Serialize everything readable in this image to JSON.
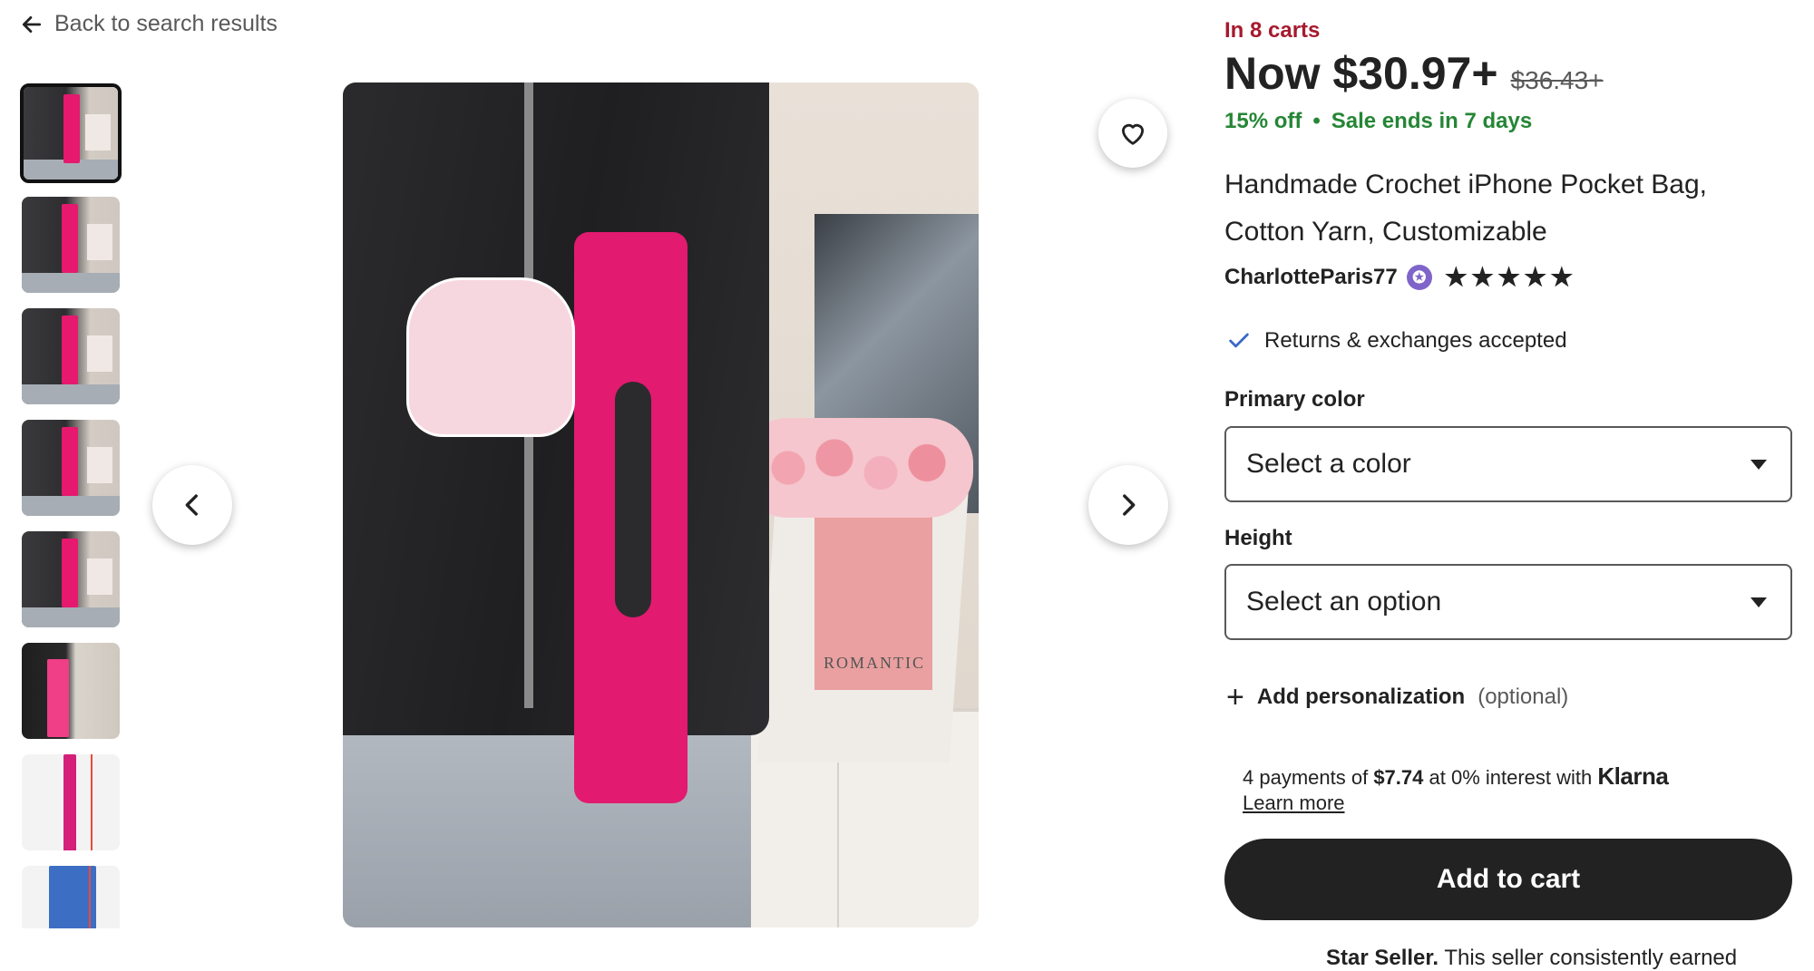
{
  "nav": {
    "back_label": "Back to search results"
  },
  "gallery": {
    "thumbnail_count": 8,
    "active_index": 0,
    "photo_caption": "ROMANTIC"
  },
  "product": {
    "in_carts": "In 8 carts",
    "price_now": "Now $30.97+",
    "price_old": "$36.43+",
    "discount": "15% off",
    "separator": "•",
    "sale_ends": "Sale ends in 7 days",
    "title": "Handmade Crochet iPhone Pocket Bag, Cotton Yarn, Customizable",
    "seller": "CharlotteParis77",
    "rating_stars": 5,
    "returns": "Returns & exchanges accepted"
  },
  "options": {
    "primary_color_label": "Primary color",
    "primary_color_value": "Select a color",
    "height_label": "Height",
    "height_value": "Select an option",
    "personalization_label": "Add personalization",
    "personalization_optional": "(optional)"
  },
  "payment": {
    "prefix": "4 payments of",
    "amount": "$7.74",
    "middle": "at 0% interest with",
    "provider": "Klarna",
    "learn_more": "Learn more"
  },
  "actions": {
    "add_to_cart": "Add to cart"
  },
  "footer": {
    "star_seller_bold": "Star Seller.",
    "star_seller_text": "This seller consistently earned"
  },
  "colors": {
    "accent_red": "#a61a2e",
    "sale_green": "#258635",
    "star_seller_badge": "#7f65c9",
    "button_dark": "#222222"
  },
  "icons": {
    "back": "arrow-left-icon",
    "favorite": "heart-icon",
    "prev": "chevron-left-icon",
    "next": "chevron-right-icon",
    "returns": "checkmark-icon",
    "add": "plus-icon"
  }
}
